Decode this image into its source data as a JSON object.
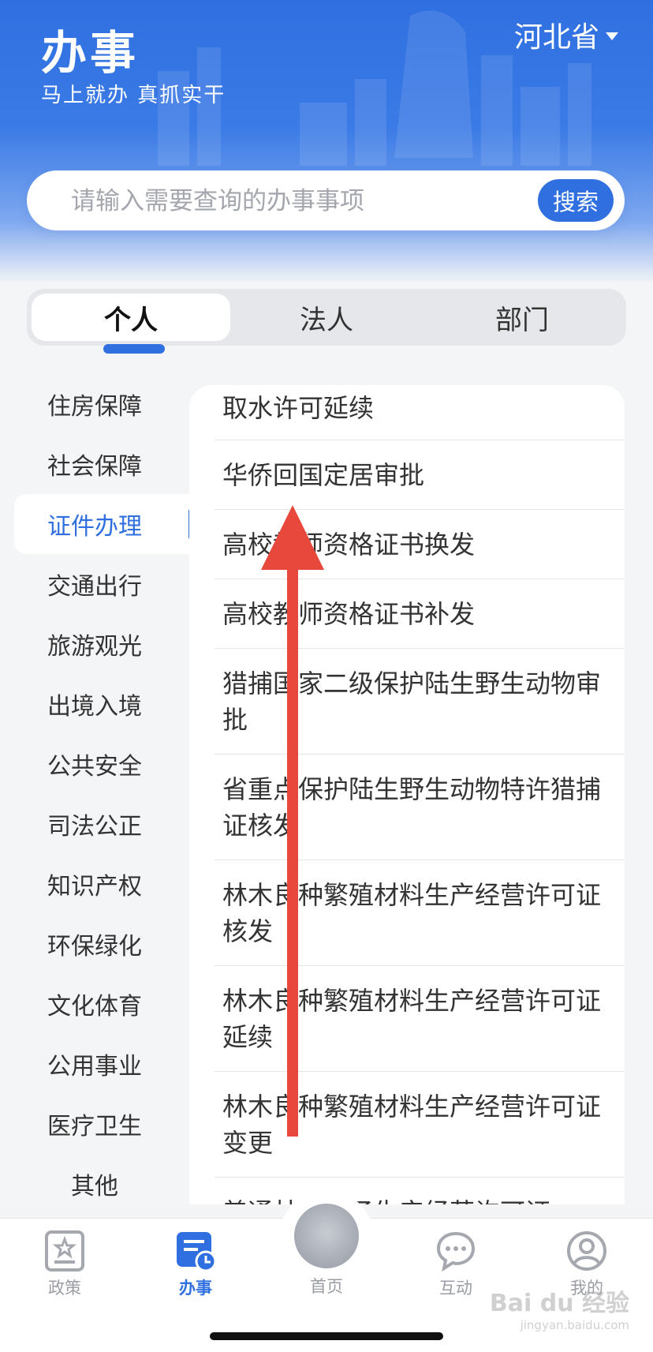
{
  "header": {
    "title": "办事",
    "subtitle": "马上就办  真抓实干",
    "region": "河北省"
  },
  "search": {
    "placeholder": "请输入需要查询的办事事项",
    "button_label": "搜索"
  },
  "tabs": [
    {
      "label": "个人",
      "active": true
    },
    {
      "label": "法人",
      "active": false
    },
    {
      "label": "部门",
      "active": false
    }
  ],
  "categories": [
    "住房保障",
    "社会保障",
    "证件办理",
    "交通出行",
    "旅游观光",
    "出境入境",
    "公共安全",
    "司法公正",
    "知识产权",
    "环保绿化",
    "文化体育",
    "公用事业",
    "医疗卫生",
    "其他"
  ],
  "active_category": "证件办理",
  "items": [
    "取水许可延续",
    "华侨回国定居审批",
    "高校教师资格证书换发",
    "高校教师资格证书补发",
    "猎捕国家二级保护陆生野生动物审批",
    "省重点保护陆生野生动物特许猎捕证核发",
    "林木良种繁殖材料生产经营许可证核发",
    "林木良种繁殖材料生产经营许可证延续",
    "林木良种繁殖材料生产经营许可证变更",
    "普通林木种子生产经营许可证..."
  ],
  "bottom_nav": [
    {
      "label": "政策",
      "icon": "policy-icon",
      "active": false
    },
    {
      "label": "办事",
      "icon": "affairs-icon",
      "active": true
    },
    {
      "label": "首页",
      "icon": "home-emblem-icon",
      "active": false
    },
    {
      "label": "互动",
      "icon": "chat-icon",
      "active": false
    },
    {
      "label": "我的",
      "icon": "profile-icon",
      "active": false
    }
  ],
  "watermark": {
    "text": "Bai du 经验",
    "sub": "jingyan.baidu.com"
  },
  "colors": {
    "brand_blue": "#2f6fe0",
    "annotation_arrow": "#e8483b"
  }
}
